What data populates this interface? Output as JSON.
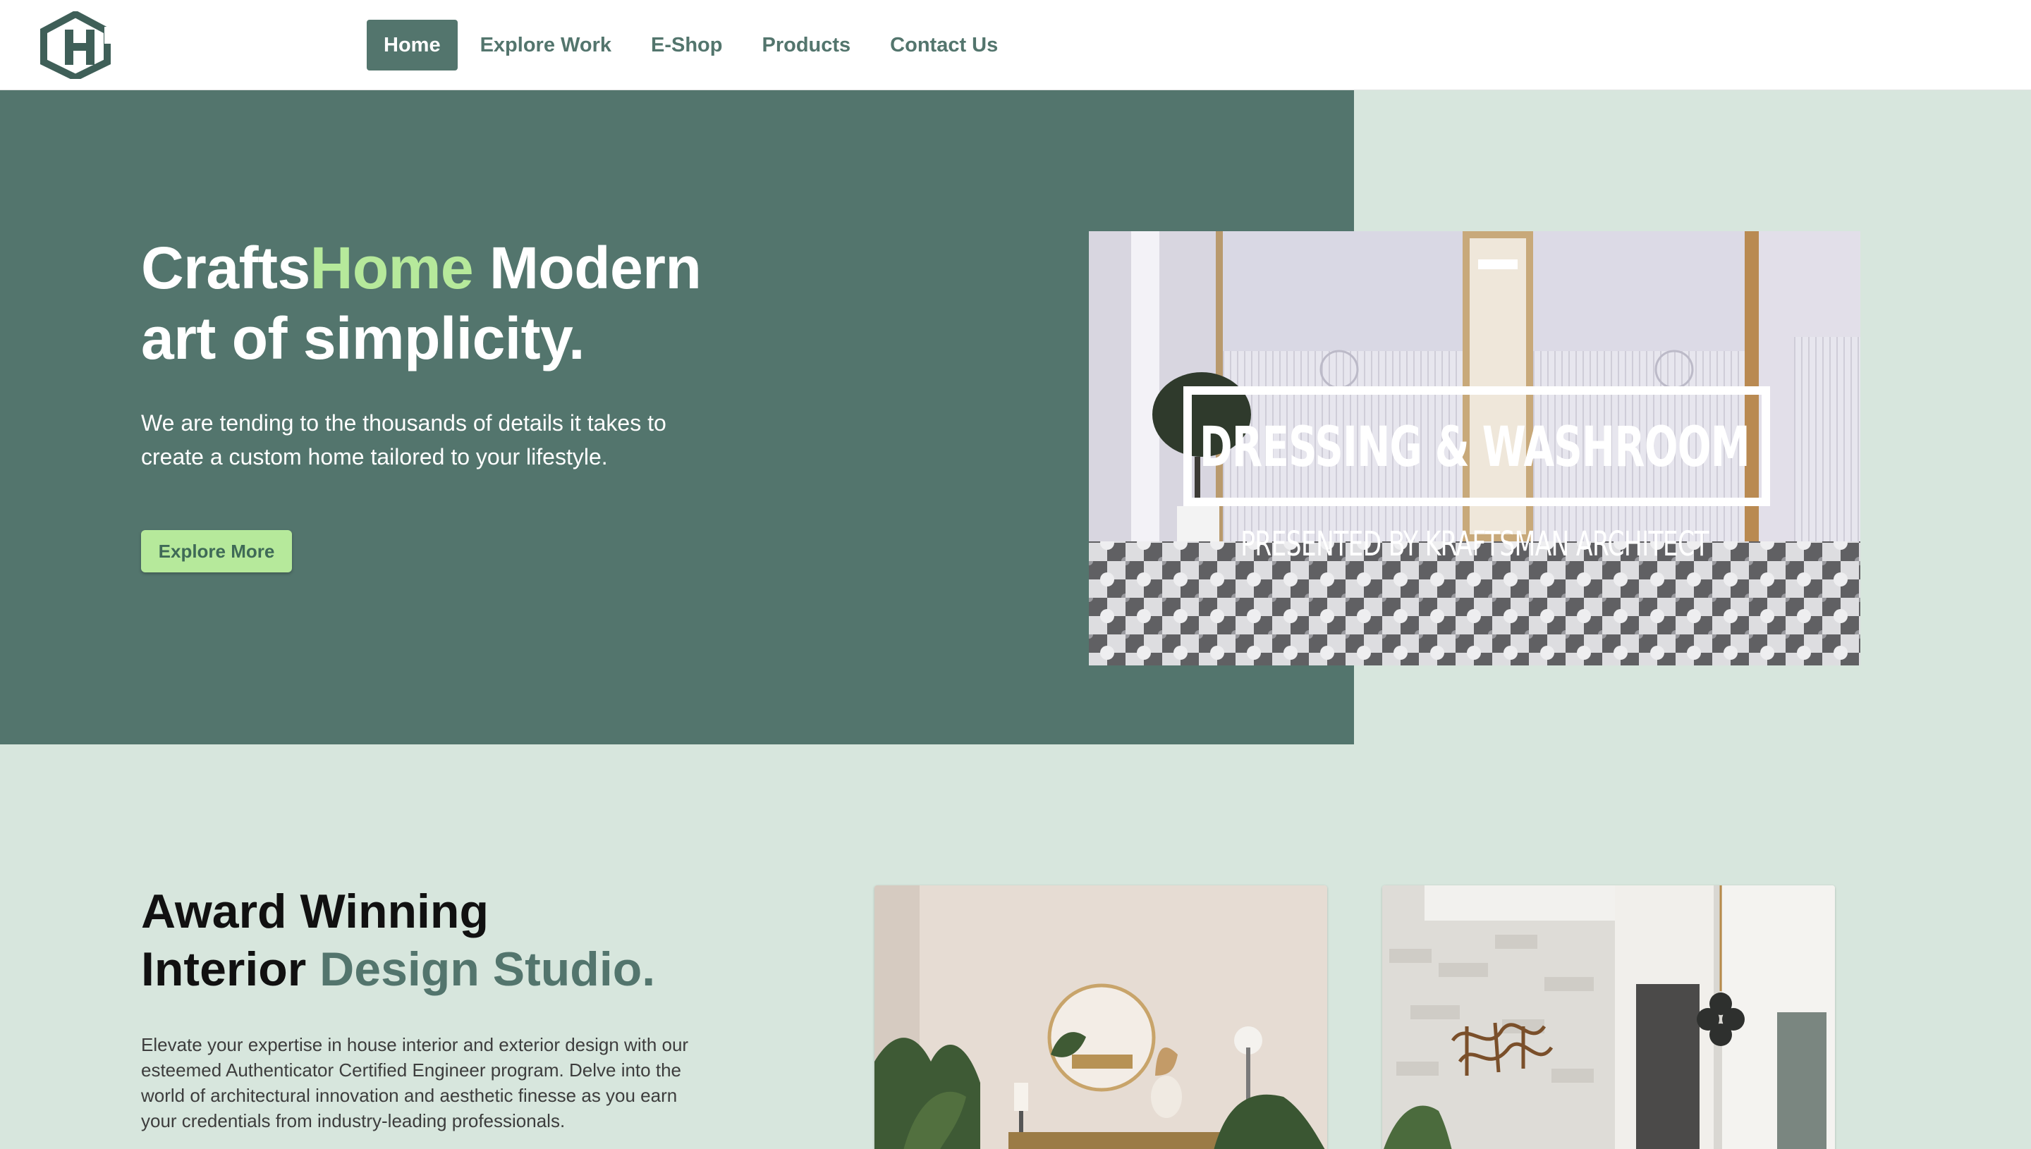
{
  "header": {
    "logo_icon": "ch-monogram-icon",
    "nav": [
      {
        "label": "Home",
        "active": true
      },
      {
        "label": "Explore Work",
        "active": false
      },
      {
        "label": "E-Shop",
        "active": false
      },
      {
        "label": "Products",
        "active": false
      },
      {
        "label": "Contact Us",
        "active": false
      }
    ]
  },
  "hero": {
    "title_part1": "Crafts",
    "title_accent": "Home",
    "title_part2": " Modern",
    "title_line2": "art of simplicity.",
    "subtitle": "We are tending to the thousands of details it takes to create a custom home tailored to your lifestyle.",
    "cta_label": "Explore More",
    "video": {
      "title": "DRESSING & WASHROOM",
      "subtitle": "PRESENTED BY KRAFTSMAN ARCHITECT"
    }
  },
  "studio": {
    "title_line1": "Award Winning",
    "title_line2_plain": "Interior ",
    "title_line2_accent": "Design Studio.",
    "description": "Elevate your expertise in house interior and exterior design with our esteemed Authenticator Certified Engineer program. Delve into the world of architectural innovation and aesthetic finesse as you earn your credentials from industry-leading professionals."
  },
  "colors": {
    "primary": "#53756d",
    "accent": "#b6e99b",
    "section_bg": "#d7e6dd",
    "header_bg": "#ffffff"
  }
}
